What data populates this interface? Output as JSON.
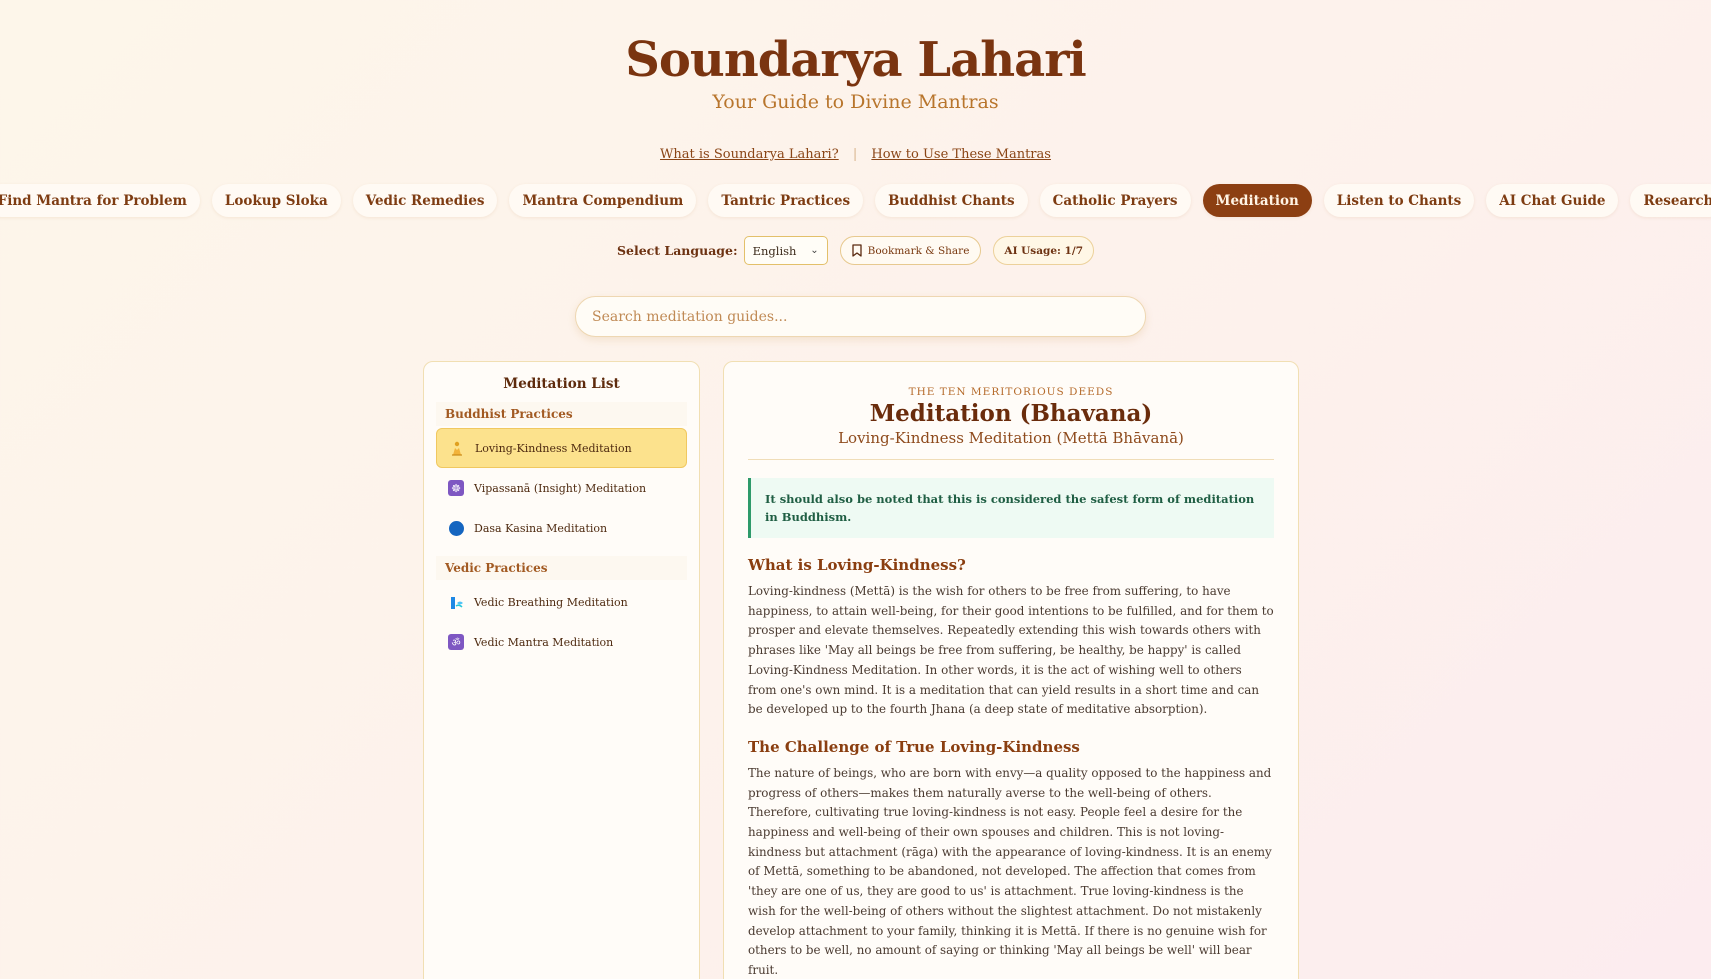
{
  "header": {
    "title": "Soundarya Lahari",
    "subtitle": "Your Guide to Divine Mantras"
  },
  "info_links": {
    "what_is": "What is Soundarya Lahari?",
    "separator": "|",
    "how_to": "How to Use These Mantras"
  },
  "nav": {
    "items": [
      {
        "label": "Find Mantra for Problem"
      },
      {
        "label": "Lookup Sloka"
      },
      {
        "label": "Vedic Remedies"
      },
      {
        "label": "Mantra Compendium"
      },
      {
        "label": "Tantric Practices"
      },
      {
        "label": "Buddhist Chants"
      },
      {
        "label": "Catholic Prayers"
      },
      {
        "label": "Meditation",
        "active": true
      },
      {
        "label": "Listen to Chants"
      },
      {
        "label": "AI Chat Guide"
      },
      {
        "label": "Research"
      }
    ]
  },
  "controls": {
    "language_label": "Select Language:",
    "language_value": "English",
    "bookmark_label": "Bookmark & Share",
    "usage_label": "AI Usage: 1/7"
  },
  "search": {
    "placeholder": "Search meditation guides..."
  },
  "sidebar": {
    "title": "Meditation List",
    "groups": [
      {
        "label": "Buddhist Practices",
        "items": [
          {
            "label": "Loving-Kindness Meditation",
            "icon": "person-praying-icon",
            "active": true
          },
          {
            "label": "Vipassanā (Insight) Meditation",
            "icon": "dharma-wheel-icon"
          },
          {
            "label": "Dasa Kasina Meditation",
            "icon": "blue-circle-icon"
          }
        ]
      },
      {
        "label": "Vedic Practices",
        "items": [
          {
            "label": "Vedic Breathing Meditation",
            "icon": "lungs-icon"
          },
          {
            "label": "Vedic Mantra Meditation",
            "icon": "om-icon"
          }
        ]
      }
    ]
  },
  "content": {
    "eyebrow": "THE TEN MERITORIOUS DEEDS",
    "title": "Meditation (Bhavana)",
    "subtitle": "Loving-Kindness Meditation (Mettā Bhāvanā)",
    "note": "It should also be noted that this is considered the safest form of meditation in Buddhism.",
    "sections": [
      {
        "heading": "What is Loving-Kindness?",
        "body": "Loving-kindness (Mettā) is the wish for others to be free from suffering, to have happiness, to attain well-being, for their good intentions to be fulfilled, and for them to prosper and elevate themselves. Repeatedly extending this wish towards others with phrases like 'May all beings be free from suffering, be healthy, be happy' is called Loving-Kindness Meditation. In other words, it is the act of wishing well to others from one's own mind. It is a meditation that can yield results in a short time and can be developed up to the fourth Jhana (a deep state of meditative absorption)."
      },
      {
        "heading": "The Challenge of True Loving-Kindness",
        "body": "The nature of beings, who are born with envy—a quality opposed to the happiness and progress of others—makes them naturally averse to the well-being of others. Therefore, cultivating true loving-kindness is not easy. People feel a desire for the happiness and well-being of their own spouses and children. This is not loving-kindness but attachment (rāga) with the appearance of loving-kindness. It is an enemy of Mettā, something to be abandoned, not developed. The affection that comes from 'they are one of us, they are good to us' is attachment. True loving-kindness is the wish for the well-being of others without the slightest attachment. Do not mistakenly develop attachment to your family, thinking it is Mettā. If there is no genuine wish for others to be well, no amount of saying or thinking 'May all beings be well' will bear fruit."
      }
    ]
  },
  "colors": {
    "brand": "#7a3410",
    "accent": "#8c3f12",
    "active_item": "#fce28d",
    "note_border": "#2e9a6a"
  }
}
